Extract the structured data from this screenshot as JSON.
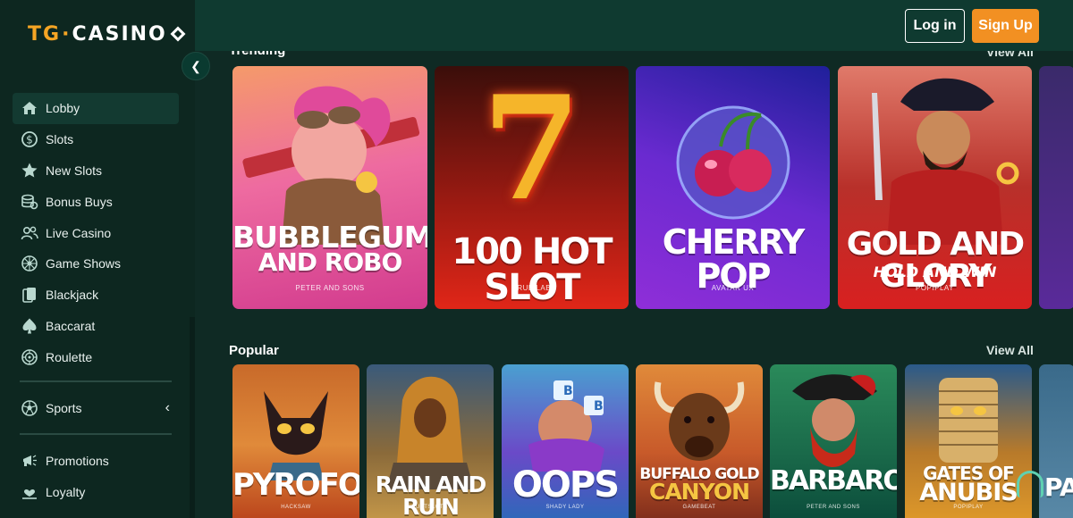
{
  "brand": {
    "logo_tg": "TG",
    "logo_dot": "·",
    "logo_casino": "CASINO"
  },
  "header": {
    "login_label": "Log in",
    "signup_label": "Sign Up"
  },
  "sidebar": {
    "collapse_icon": "chevron-left-icon",
    "items": [
      {
        "label": "Lobby",
        "icon": "home-icon"
      },
      {
        "label": "Slots",
        "icon": "dollar-coin-icon"
      },
      {
        "label": "New Slots",
        "icon": "star-icon"
      },
      {
        "label": "Bonus Buys",
        "icon": "coin-stack-icon"
      },
      {
        "label": "Live Casino",
        "icon": "users-icon"
      },
      {
        "label": "Game Shows",
        "icon": "wheel-icon"
      },
      {
        "label": "Blackjack",
        "icon": "cards-icon"
      },
      {
        "label": "Baccarat",
        "icon": "spade-icon"
      },
      {
        "label": "Roulette",
        "icon": "roulette-icon"
      }
    ],
    "sports": {
      "label": "Sports",
      "icon": "soccer-ball-icon"
    },
    "extra": [
      {
        "label": "Promotions",
        "icon": "megaphone-icon"
      },
      {
        "label": "Loyalty",
        "icon": "heart-hand-icon"
      }
    ]
  },
  "trending": {
    "title": "Trending",
    "view_all": "View All",
    "games": [
      {
        "title": "BUBBLEGUM AND ROBO",
        "line1": "BUBBLEGUM",
        "line2": "AND ROBO",
        "provider": "PETER AND SONS"
      },
      {
        "title": "100 HOT SLOT",
        "provider": "TRUE LAB",
        "big": "7"
      },
      {
        "title": "CHERRY POP",
        "provider": "AVATAR UX"
      },
      {
        "title": "GOLD AND GLORY",
        "sub": "HOLD AND WIN",
        "provider": "POPIPLAY"
      }
    ]
  },
  "popular": {
    "title": "Popular",
    "view_all": "View All",
    "games": [
      {
        "title": "PYROFOX",
        "provider": "HACKSAW"
      },
      {
        "title": "RAIN AND RUIN",
        "provider": "JUSTSLOTS"
      },
      {
        "title": "OOPS",
        "provider": "SHADY LADY"
      },
      {
        "title": "BUFFALO GOLD CANYON",
        "line1": "BUFFALO GOLD",
        "line2": "CANYON",
        "provider": "GAMEBEAT"
      },
      {
        "title": "BARBAROSSA",
        "provider": "PETER AND SONS"
      },
      {
        "title": "GATES OF ANUBIS",
        "line1": "GATES OF",
        "line2": "ANUBIS",
        "provider": "POPIPLAY"
      },
      {
        "title": "PA"
      }
    ]
  },
  "colors": {
    "accent": "#f29022",
    "background": "#0f2a24",
    "sidebar": "#0d2720",
    "header": "#0f3a30"
  }
}
